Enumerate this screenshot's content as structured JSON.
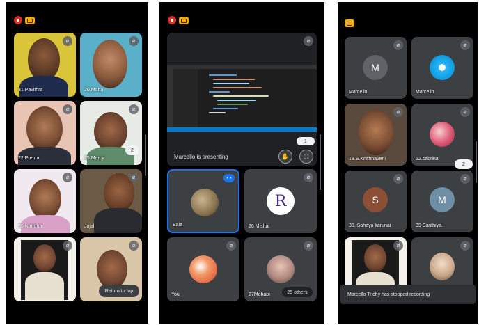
{
  "screen1": {
    "tiles": [
      {
        "name": "31.Pavithra"
      },
      {
        "name": "20.Maha"
      },
      {
        "name": "22.Prema"
      },
      {
        "name": "25.Mercy"
      },
      {
        "name": "36.Nandha"
      },
      {
        "name": "Jojal"
      },
      {
        "name": ""
      },
      {
        "name": ""
      }
    ],
    "page_badge": "2",
    "return_to_top": "Return to top"
  },
  "screen2": {
    "presenter_text": "Marcello is presenting",
    "page_badge": "1",
    "tiles": [
      {
        "name": "Bala"
      },
      {
        "name": "26 Mishal"
      },
      {
        "name": "You"
      },
      {
        "name": "27Mohabi"
      }
    ],
    "others_label": "25 others",
    "speaking_dots": "• •"
  },
  "screen3": {
    "tiles": [
      {
        "name": "Marcello",
        "initial": "M"
      },
      {
        "name": "Marcello"
      },
      {
        "name": "18.S.Krishnaveni"
      },
      {
        "name": "22.sabrina"
      },
      {
        "name": "38. Sahaya karunai",
        "initial": "S"
      },
      {
        "name": "39 Santhiya.",
        "initial": "M"
      },
      {
        "name": ""
      },
      {
        "name": ""
      }
    ],
    "page_badge": "2",
    "toast": "Marcello Trichy has stopped recording"
  },
  "colors": {
    "background": "#000000",
    "tile": "#3c4043",
    "record": "#d93025",
    "cast": "#f9ab00",
    "active_border": "#1a73e8"
  },
  "icons": [
    "record-icon",
    "cast-icon",
    "mic-off-icon",
    "hand-raise-icon",
    "fullscreen-icon"
  ]
}
